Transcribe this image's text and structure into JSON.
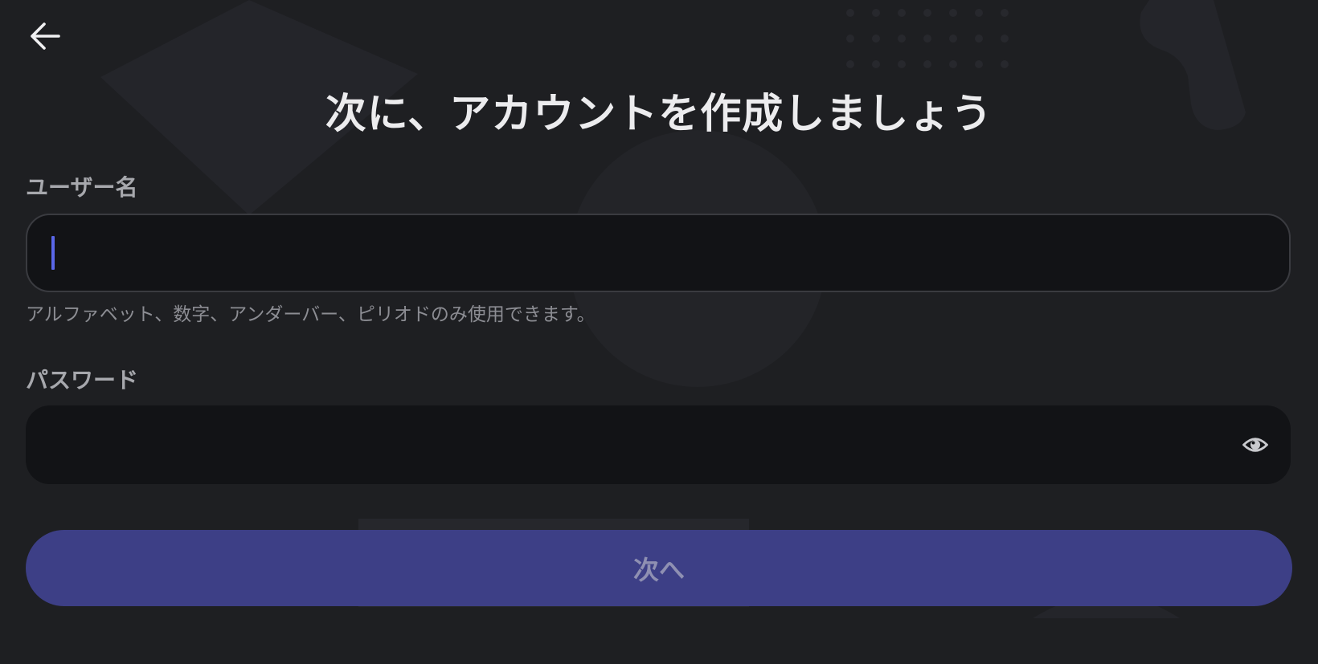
{
  "header": {
    "back_icon": "arrow-left-icon",
    "title": "次に、アカウントを作成しましょう"
  },
  "username": {
    "label": "ユーザー名",
    "value": "",
    "hint": "アルファベット、数字、アンダーバー、ピリオドのみ使用できます。"
  },
  "password": {
    "label": "パスワード",
    "value": "",
    "toggle_icon": "eye-icon"
  },
  "actions": {
    "next_label": "次へ"
  },
  "colors": {
    "background": "#1e1f22",
    "input_bg": "#121316",
    "accent": "#3d3f86",
    "caret": "#5a67e8"
  }
}
